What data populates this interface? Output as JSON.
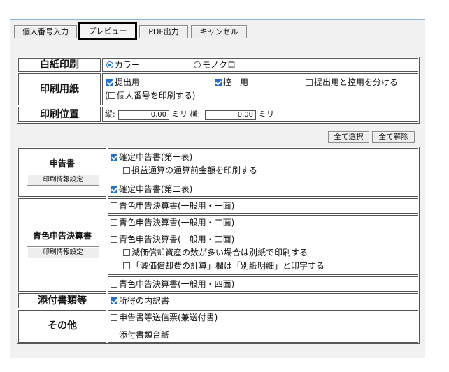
{
  "toolbar": {
    "mynumber_button": "個人番号入力",
    "preview_button": "プレビュー",
    "pdf_button": "PDF出力",
    "cancel_button": "キャンセル"
  },
  "settings": {
    "paper": {
      "label": "白紙印刷",
      "option_color": "カラー",
      "option_mono": "モノクロ",
      "selected": "カラー"
    },
    "paper_type": {
      "label": "印刷用紙",
      "submit_copy": "提出用",
      "submit_copy_checked": true,
      "keep_copy": "控　用",
      "keep_copy_checked": true,
      "split_option": "提出用と控用を分ける",
      "split_option_checked": false,
      "mynumber_prefix": "(",
      "mynumber_option": "個人番号を印刷する)",
      "mynumber_option_checked": false
    },
    "position": {
      "label": "印刷位置",
      "vertical_label": "縦:",
      "vertical_value": "0.00",
      "vertical_unit": "ミリ 横:",
      "horizontal_value": "0.00",
      "horizontal_unit": "ミリ"
    }
  },
  "actions": {
    "select_all": "全て選択",
    "clear_all": "全て解除"
  },
  "forms": {
    "return_group": {
      "label": "申告書",
      "settings_button": "印刷情報設定",
      "form1": "確定申告書(第一表)",
      "form1_checked": true,
      "form1_sub": "損益通算の通算前金額を印刷する",
      "form1_sub_checked": false,
      "form2": "確定申告書(第二表)",
      "form2_checked": true
    },
    "blue_group": {
      "label": "青色申告決算書",
      "settings_button": "印刷情報設定",
      "p1": "青色申告決算書(一般用・一面)",
      "p1_checked": false,
      "p2": "青色申告決算書(一般用・二面)",
      "p2_checked": false,
      "p3": "青色申告決算書(一般用・三面)",
      "p3_checked": false,
      "p3_sub1": "減価償却資産の数が多い場合は別紙で印刷する",
      "p3_sub1_checked": false,
      "p3_sub2": "「減価償却費の計算」欄は「別紙明細」と印字する",
      "p3_sub2_checked": false,
      "p4": "青色申告決算書(一般用・四面)",
      "p4_checked": false
    },
    "attach_group": {
      "label": "添付書類等",
      "item": "所得の内訳書",
      "item_checked": true
    },
    "other_group": {
      "label": "その他",
      "item1": "申告書等送信票(兼送付書)",
      "item1_checked": false,
      "item2": "添付書類台紙",
      "item2_checked": false
    }
  }
}
